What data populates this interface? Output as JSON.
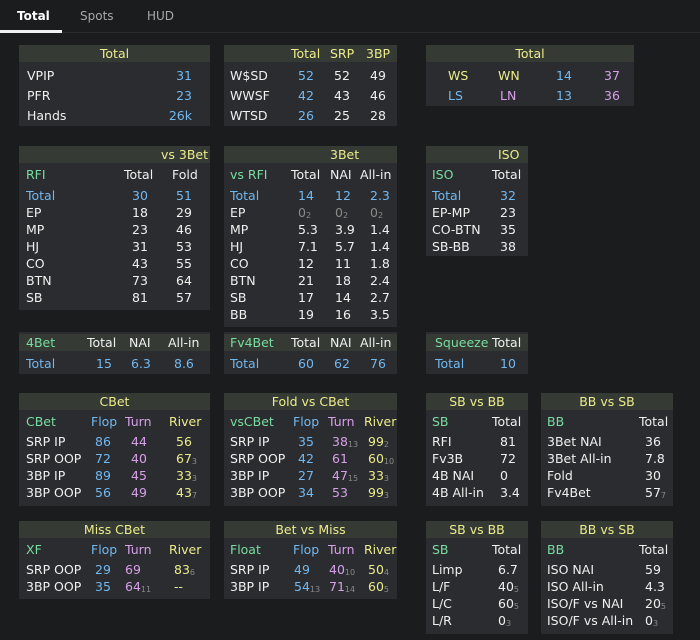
{
  "tabs": [
    "Total",
    "Spots",
    "HUD"
  ],
  "total": {
    "title": "Total",
    "vpip_label": "VPIP",
    "vpip": "31",
    "pfr_label": "PFR",
    "pfr": "23",
    "hands_label": "Hands",
    "hands": "26k"
  },
  "showdown": {
    "h1": "Total",
    "h2": "SRP",
    "h3": "3BP",
    "rows": [
      [
        "W$SD",
        "52",
        "52",
        "49"
      ],
      [
        "WWSF",
        "42",
        "43",
        "46"
      ],
      [
        "WTSD",
        "26",
        "25",
        "28"
      ]
    ]
  },
  "ws": {
    "title": "Total",
    "r1": [
      "WS",
      "WN",
      "14",
      "37"
    ],
    "r2": [
      "LS",
      "LN",
      "13",
      "36"
    ]
  },
  "vs3bet": {
    "title": "vs 3Bet",
    "h0": "RFI",
    "h1": "Total",
    "h2": "Fold",
    "rows": [
      [
        "Total",
        "30",
        "51"
      ],
      [
        "EP",
        "18",
        "29"
      ],
      [
        "MP",
        "23",
        "46"
      ],
      [
        "HJ",
        "31",
        "53"
      ],
      [
        "CO",
        "43",
        "55"
      ],
      [
        "BTN",
        "73",
        "64"
      ],
      [
        "SB",
        "81",
        "57"
      ]
    ]
  },
  "threebet": {
    "title": "3Bet",
    "h0": "vs RFI",
    "h1": "Total",
    "h2": "NAI",
    "h3": "All-in",
    "rows": [
      [
        "Total",
        "14",
        "12",
        "2.3"
      ],
      [
        "EP",
        "0",
        "0",
        "0"
      ],
      [
        "MP",
        "5.3",
        "3.9",
        "1.4"
      ],
      [
        "HJ",
        "7.1",
        "5.7",
        "1.4"
      ],
      [
        "CO",
        "12",
        "11",
        "1.8"
      ],
      [
        "BTN",
        "21",
        "18",
        "2.4"
      ],
      [
        "SB",
        "17",
        "14",
        "2.7"
      ],
      [
        "BB",
        "19",
        "16",
        "3.5"
      ]
    ],
    "ep_subs": [
      "2",
      "2",
      "2"
    ]
  },
  "iso": {
    "title": "ISO",
    "h0": "ISO",
    "h1": "Total",
    "rows": [
      [
        "Total",
        "32"
      ],
      [
        "EP-MP",
        "23"
      ],
      [
        "CO-BTN",
        "35"
      ],
      [
        "SB-BB",
        "38"
      ]
    ]
  },
  "fourbet": {
    "h0": "4Bet",
    "h1": "Total",
    "h2": "NAI",
    "h3": "All-in",
    "row": [
      "Total",
      "15",
      "6.3",
      "8.6"
    ]
  },
  "fv4bet": {
    "h0": "Fv4Bet",
    "h1": "Total",
    "h2": "NAI",
    "h3": "All-in",
    "row": [
      "Total",
      "60",
      "62",
      "76"
    ]
  },
  "squeeze": {
    "h0": "Squeeze",
    "h1": "Total",
    "row": [
      "Total",
      "10"
    ]
  },
  "cbet": {
    "title": "CBet",
    "h0": "CBet",
    "h1": "Flop",
    "h2": "Turn",
    "h3": "River",
    "rows": [
      [
        "SRP IP",
        "86",
        "44",
        "56",
        ""
      ],
      [
        "SRP OOP",
        "72",
        "40",
        "67",
        "3"
      ],
      [
        "3BP IP",
        "89",
        "45",
        "33",
        "3"
      ],
      [
        "3BP OOP",
        "56",
        "49",
        "43",
        "7"
      ]
    ]
  },
  "foldcbet": {
    "title": "Fold vs CBet",
    "h0": "vsCBet",
    "h1": "Flop",
    "h2": "Turn",
    "h3": "River",
    "rows": [
      [
        "SRP IP",
        "35",
        "38",
        "13",
        "99",
        "2"
      ],
      [
        "SRP OOP",
        "42",
        "61",
        "",
        "60",
        "10"
      ],
      [
        "3BP IP",
        "27",
        "47",
        "15",
        "33",
        "3"
      ],
      [
        "3BP OOP",
        "34",
        "53",
        "",
        "99",
        "3"
      ]
    ]
  },
  "sbvsbb": {
    "title": "SB vs BB",
    "h0": "SB",
    "h1": "Total",
    "rows": [
      [
        "RFI",
        "81"
      ],
      [
        "Fv3B",
        "72"
      ],
      [
        "4B NAI",
        "0"
      ],
      [
        "4B All-in",
        "3.4"
      ]
    ]
  },
  "bbvssb": {
    "title": "BB vs SB",
    "h0": "BB",
    "h1": "Total",
    "rows": [
      [
        "3Bet NAI",
        "36",
        ""
      ],
      [
        "3Bet All-in",
        "7.8",
        ""
      ],
      [
        "Fold",
        "30",
        ""
      ],
      [
        "Fv4Bet",
        "57",
        "7"
      ]
    ]
  },
  "misscbet": {
    "title": "Miss CBet",
    "h0": "XF",
    "h1": "Flop",
    "h2": "Turn",
    "h3": "River",
    "rows": [
      [
        "SRP OOP",
        "29",
        "",
        "69",
        "",
        "83",
        "6"
      ],
      [
        "3BP OOP",
        "35",
        "",
        "64",
        "11",
        "--",
        ""
      ]
    ]
  },
  "betvsmiss": {
    "title": "Bet vs Miss",
    "h0": "Float",
    "h1": "Flop",
    "h2": "Turn",
    "h3": "River",
    "rows": [
      [
        "SRP IP",
        "49",
        "",
        "40",
        "10",
        "50",
        "4"
      ],
      [
        "3BP IP",
        "54",
        "13",
        "71",
        "14",
        "60",
        "5"
      ]
    ]
  },
  "sbvsbb2": {
    "title": "SB vs BB",
    "h0": "SB",
    "h1": "Total",
    "rows": [
      [
        "Limp",
        "6.7",
        ""
      ],
      [
        "L/F",
        "40",
        "5"
      ],
      [
        "L/C",
        "60",
        "5"
      ],
      [
        "L/R",
        "0",
        "3"
      ]
    ]
  },
  "bbvssb2": {
    "title": "BB vs SB",
    "h0": "BB",
    "h1": "Total",
    "rows": [
      [
        "ISO NAI",
        "59",
        ""
      ],
      [
        "ISO All-in",
        "4.3",
        ""
      ],
      [
        "ISO/F vs NAI",
        "20",
        "5"
      ],
      [
        "ISO/F vs All-in",
        "0",
        "3"
      ]
    ]
  }
}
